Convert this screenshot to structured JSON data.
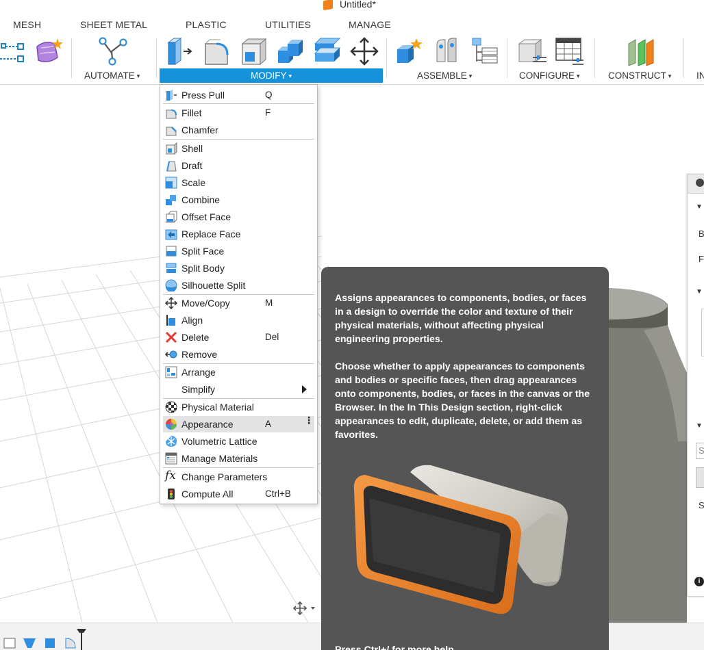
{
  "window": {
    "title": "Untitled*"
  },
  "ribbon": {
    "tabs": [
      "MESH",
      "SHEET METAL",
      "PLASTIC",
      "UTILITIES",
      "MANAGE"
    ],
    "groups": {
      "automate": "AUTOMATE",
      "modify": "MODIFY",
      "assemble": "ASSEMBLE",
      "configure": "CONFIGURE",
      "construct": "CONSTRUCT",
      "inspect_partial": "IN"
    },
    "caret": "▾"
  },
  "modify_menu": {
    "items": [
      {
        "label": "Press Pull",
        "shortcut": "Q",
        "icon": "press-pull-icon"
      },
      {
        "label": "Fillet",
        "shortcut": "F",
        "icon": "fillet-icon"
      },
      {
        "label": "Chamfer",
        "shortcut": "",
        "icon": "chamfer-icon"
      },
      {
        "label": "Shell",
        "shortcut": "",
        "icon": "shell-icon"
      },
      {
        "label": "Draft",
        "shortcut": "",
        "icon": "draft-icon"
      },
      {
        "label": "Scale",
        "shortcut": "",
        "icon": "scale-icon"
      },
      {
        "label": "Combine",
        "shortcut": "",
        "icon": "combine-icon"
      },
      {
        "label": "Offset Face",
        "shortcut": "",
        "icon": "offset-face-icon"
      },
      {
        "label": "Replace Face",
        "shortcut": "",
        "icon": "replace-face-icon"
      },
      {
        "label": "Split Face",
        "shortcut": "",
        "icon": "split-face-icon"
      },
      {
        "label": "Split Body",
        "shortcut": "",
        "icon": "split-body-icon"
      },
      {
        "label": "Silhouette Split",
        "shortcut": "",
        "icon": "silhouette-split-icon"
      },
      {
        "label": "Move/Copy",
        "shortcut": "M",
        "icon": "move-copy-icon"
      },
      {
        "label": "Align",
        "shortcut": "",
        "icon": "align-icon"
      },
      {
        "label": "Delete",
        "shortcut": "Del",
        "icon": "delete-icon"
      },
      {
        "label": "Remove",
        "shortcut": "",
        "icon": "remove-icon"
      },
      {
        "label": "Arrange",
        "shortcut": "",
        "icon": "arrange-icon"
      },
      {
        "label": "Simplify",
        "shortcut": "",
        "icon": "submenu-arrow-icon"
      },
      {
        "label": "Physical Material",
        "shortcut": "",
        "icon": "physical-material-icon"
      },
      {
        "label": "Appearance",
        "shortcut": "A",
        "icon": "appearance-icon"
      },
      {
        "label": "Volumetric Lattice",
        "shortcut": "",
        "icon": "volumetric-lattice-icon"
      },
      {
        "label": "Manage Materials",
        "shortcut": "",
        "icon": "manage-materials-icon"
      },
      {
        "label": "Change Parameters",
        "shortcut": "",
        "icon": "fx-icon"
      },
      {
        "label": "Compute All",
        "shortcut": "Ctrl+B",
        "icon": "compute-all-icon"
      }
    ],
    "highlighted": "Appearance",
    "more_glyph": "⋮"
  },
  "tooltip": {
    "paragraph1": "Assigns appearances to components, bodies, or faces in a design to override the color and texture of their physical materials, without affecting physical engineering properties.",
    "paragraph2": "Choose whether to apply appearances to components and bodies or specific faces, then drag appearances onto components, bodies, or faces in the canvas or the Browser. In the In This Design section, right-click appearances to edit, duplicate, delete, or add them as favorites.",
    "help": "Press Ctrl+/ for more help"
  },
  "right_panel": {
    "labels": [
      "B",
      "Fa",
      "S"
    ],
    "search_placeholder": "S"
  },
  "colors": {
    "accent": "#1592d9",
    "tooltip_bg": "#555555",
    "orange": "#f0821e",
    "delete_red": "#e03c31"
  }
}
